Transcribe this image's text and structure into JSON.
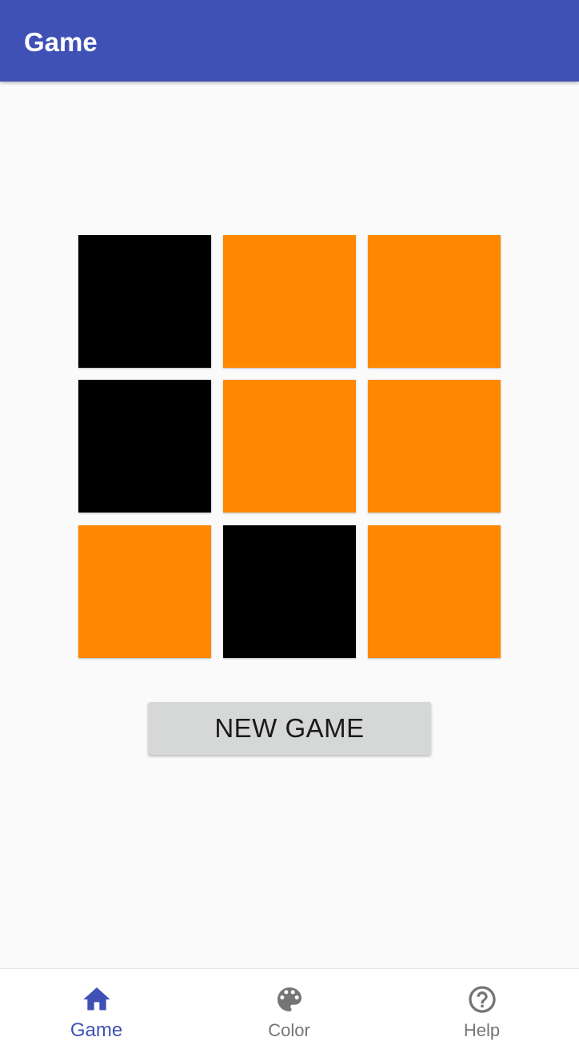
{
  "app_bar": {
    "title": "Game",
    "color": "#3f51b5"
  },
  "board": {
    "colors": {
      "black": "#000000",
      "orange": "#ff8800"
    },
    "cells": [
      [
        "black",
        "orange",
        "orange"
      ],
      [
        "black",
        "orange",
        "orange"
      ],
      [
        "orange",
        "black",
        "orange"
      ]
    ]
  },
  "actions": {
    "new_game_label": "NEW GAME"
  },
  "bottom_nav": {
    "active_color": "#3f51b5",
    "inactive_color": "#757575",
    "items": [
      {
        "label": "Game",
        "icon": "home-icon",
        "active": true
      },
      {
        "label": "Color",
        "icon": "palette-icon",
        "active": false
      },
      {
        "label": "Help",
        "icon": "help-circle-icon",
        "active": false
      }
    ]
  }
}
